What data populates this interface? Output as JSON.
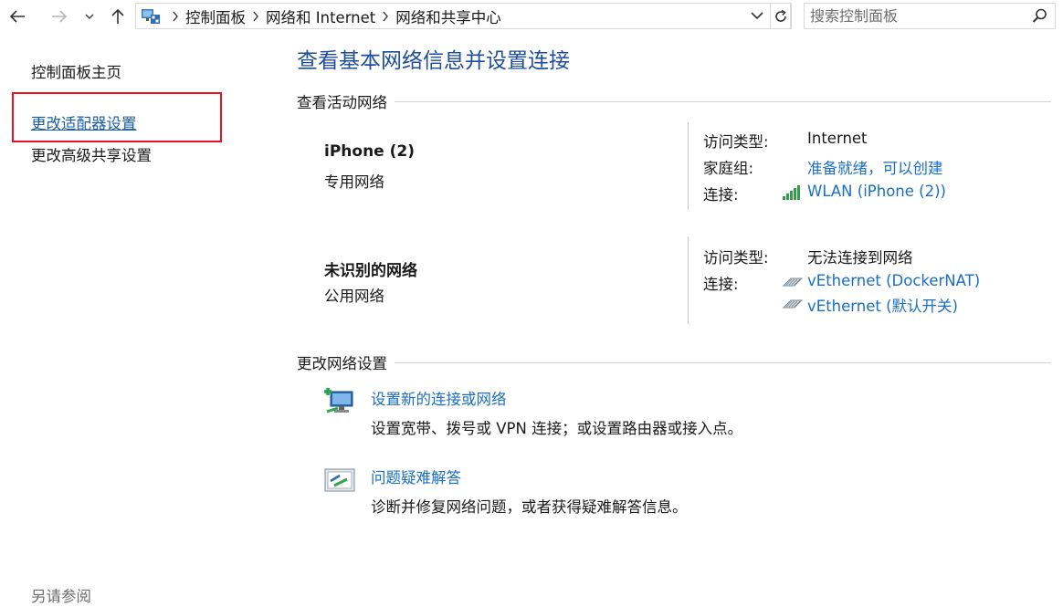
{
  "breadcrumb": [
    "控制面板",
    "网络和 Internet",
    "网络和共享中心"
  ],
  "search": {
    "placeholder": "搜索控制面板"
  },
  "left_pane": {
    "home": "控制面板主页",
    "change_adapter": "更改适配器设置",
    "change_sharing": "更改高级共享设置",
    "see_also": "另请参阅"
  },
  "main": {
    "title": "查看基本网络信息并设置连接",
    "active_networks_heading": "查看活动网络",
    "networks": [
      {
        "name": "iPhone (2)",
        "type": "专用网络",
        "access_type_label": "访问类型:",
        "access_type": "Internet",
        "homegroup_label": "家庭组:",
        "homegroup": "准备就绪，可以创建",
        "connections_label": "连接:",
        "connections": [
          "WLAN (iPhone (2))"
        ]
      },
      {
        "name": "未识别的网络",
        "type": "公用网络",
        "access_type_label": "访问类型:",
        "access_type": "无法连接到网络",
        "connections_label": "连接:",
        "connections": [
          "vEthernet (DockerNAT)",
          "vEthernet (默认开关)"
        ]
      }
    ],
    "change_settings_heading": "更改网络设置",
    "tasks": [
      {
        "link": "设置新的连接或网络",
        "desc": "设置宽带、拨号或 VPN 连接；或设置路由器或接入点。",
        "icon": "new-connection-icon"
      },
      {
        "link": "问题疑难解答",
        "desc": "诊断并修复网络问题，或者获得疑难解答信息。",
        "icon": "troubleshoot-icon"
      }
    ]
  },
  "colors": {
    "link": "#1a6fc4",
    "title": "#1e4e9b",
    "highlight_box": "#e81123"
  }
}
